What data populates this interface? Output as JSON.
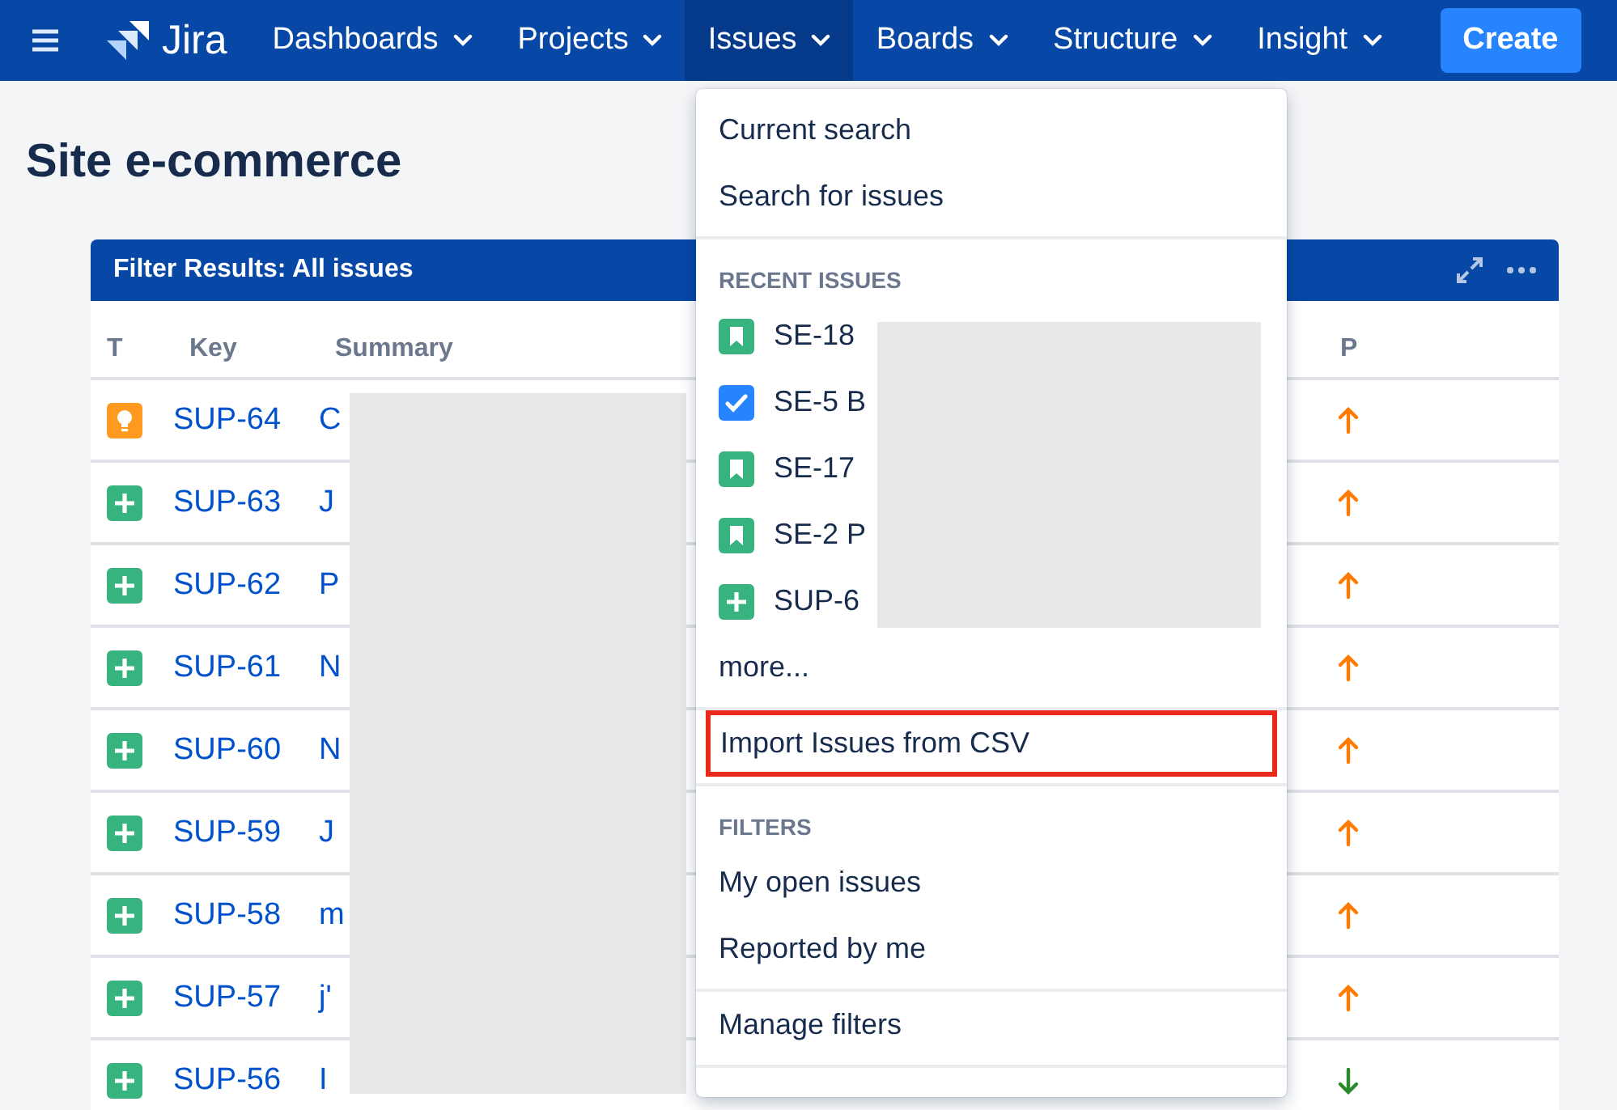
{
  "nav": {
    "logo": "Jira",
    "items": [
      {
        "label": "Dashboards",
        "selected": false
      },
      {
        "label": "Projects",
        "selected": false
      },
      {
        "label": "Issues",
        "selected": true
      },
      {
        "label": "Boards",
        "selected": false
      },
      {
        "label": "Structure",
        "selected": false
      },
      {
        "label": "Insight",
        "selected": false
      }
    ],
    "create": "Create"
  },
  "page_title": "Site e-commerce",
  "table": {
    "title": "Filter Results: All issues",
    "columns": [
      "T",
      "Key",
      "Summary",
      "P"
    ],
    "rows": [
      {
        "kind": "improvement",
        "key": "SUP-64",
        "summary": "C",
        "priority": {
          "kind": "high"
        }
      },
      {
        "kind": "new-feature",
        "key": "SUP-63",
        "summary": "J",
        "priority": {
          "kind": "high"
        }
      },
      {
        "kind": "new-feature",
        "key": "SUP-62",
        "summary": "P",
        "priority": {
          "kind": "high"
        }
      },
      {
        "kind": "new-feature",
        "key": "SUP-61",
        "summary": "N",
        "priority": {
          "kind": "high"
        }
      },
      {
        "kind": "new-feature",
        "key": "SUP-60",
        "summary": "N",
        "priority": {
          "kind": "high"
        }
      },
      {
        "kind": "new-feature",
        "key": "SUP-59",
        "summary": "J",
        "priority": {
          "kind": "high"
        }
      },
      {
        "kind": "new-feature",
        "key": "SUP-58",
        "summary": "m",
        "priority": {
          "kind": "high"
        }
      },
      {
        "kind": "new-feature",
        "key": "SUP-57",
        "summary": "j'",
        "priority": {
          "kind": "high"
        }
      },
      {
        "kind": "new-feature",
        "key": "SUP-56",
        "summary": "I",
        "priority": {
          "kind": "low"
        }
      }
    ]
  },
  "menu": {
    "sections": [
      {
        "items": [
          {
            "label": "Current search",
            "highlighted": false
          },
          {
            "label": "Search for issues",
            "highlighted": false
          }
        ]
      },
      {
        "heading": "RECENT ISSUES",
        "issues": [
          {
            "kind": "story",
            "label": "SE-18"
          },
          {
            "kind": "task",
            "label": "SE-5 B"
          },
          {
            "kind": "story",
            "label": "SE-17"
          },
          {
            "kind": "story",
            "label": "SE-2 P"
          },
          {
            "kind": "new-feature",
            "label": "SUP-6"
          }
        ],
        "items": [
          {
            "label": "more...",
            "highlighted": false
          }
        ]
      },
      {
        "items": [
          {
            "label": "Import Issues from CSV",
            "highlighted": true
          }
        ]
      },
      {
        "heading": "FILTERS",
        "items": [
          {
            "label": "My open issues",
            "highlighted": false
          },
          {
            "label": "Reported by me",
            "highlighted": false
          }
        ]
      },
      {
        "items": [
          {
            "label": "Manage filters",
            "highlighted": false
          }
        ]
      }
    ]
  }
}
